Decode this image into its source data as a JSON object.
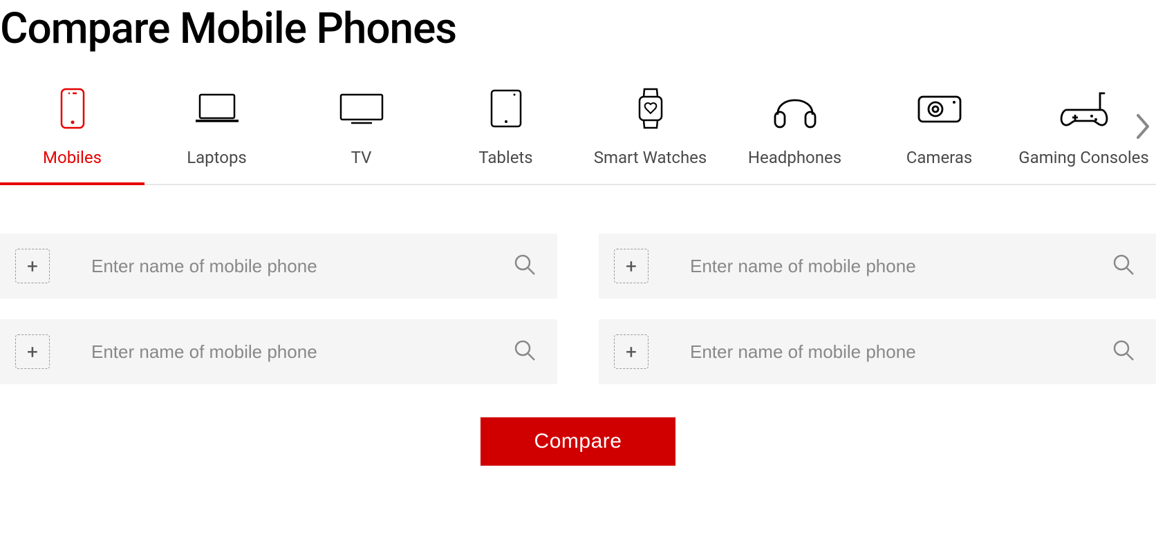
{
  "page_title": "Compare Mobile Phones",
  "tabs": [
    {
      "label": "Mobiles",
      "icon": "mobile-icon",
      "active": true
    },
    {
      "label": "Laptops",
      "icon": "laptop-icon",
      "active": false
    },
    {
      "label": "TV",
      "icon": "tv-icon",
      "active": false
    },
    {
      "label": "Tablets",
      "icon": "tablet-icon",
      "active": false
    },
    {
      "label": "Smart Watches",
      "icon": "smartwatch-icon",
      "active": false
    },
    {
      "label": "Headphones",
      "icon": "headphones-icon",
      "active": false
    },
    {
      "label": "Cameras",
      "icon": "camera-icon",
      "active": false
    },
    {
      "label": "Gaming Consoles",
      "icon": "gamepad-icon",
      "active": false
    }
  ],
  "search_placeholder": "Enter name of mobile phone",
  "plus_label": "+",
  "compare_button_label": "Compare"
}
